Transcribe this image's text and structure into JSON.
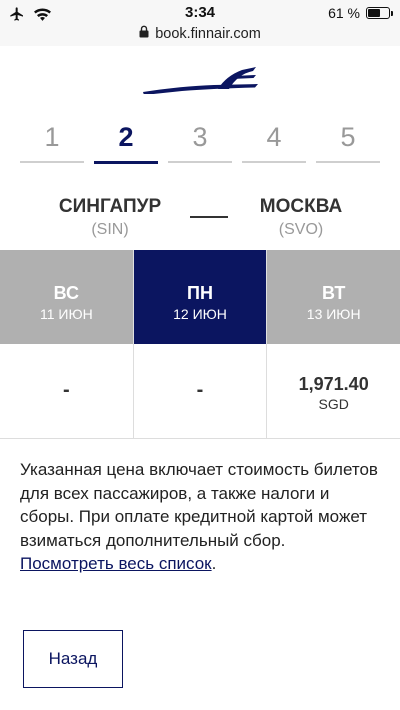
{
  "status_bar": {
    "time": "3:34",
    "battery_percent": "61 %",
    "battery_level": 0.61,
    "icons": [
      "airplane-icon",
      "wifi-icon",
      "battery-icon"
    ]
  },
  "browser": {
    "url": "book.finnair.com",
    "lock_icon": "lock-icon"
  },
  "brand": {
    "logo": "finnair-logo",
    "color": "#0b1560"
  },
  "steps": [
    {
      "label": "1"
    },
    {
      "label": "2"
    },
    {
      "label": "3"
    },
    {
      "label": "4"
    },
    {
      "label": "5"
    }
  ],
  "active_step": "2",
  "route": {
    "from_city": "СИНГАПУР",
    "from_code": "(SIN)",
    "to_city": "МОСКВА",
    "to_code": "(SVO)"
  },
  "days": [
    {
      "weekday": "ВС",
      "date": "11 ИЮН",
      "price": "-",
      "currency": ""
    },
    {
      "weekday": "ПН",
      "date": "12 ИЮН",
      "price": "-",
      "currency": ""
    },
    {
      "weekday": "ВТ",
      "date": "13 ИЮН",
      "price": "1,971.40",
      "currency": "SGD"
    }
  ],
  "selected_day": "ПН",
  "info": {
    "text": "Указанная цена включает стоимость билетов для всех пассажиров, а также налоги и сборы. При оплате кредитной картой может взиматься дополнительный сбор. ",
    "link": "Посмотреть весь список",
    "after": "."
  },
  "back_button": "Назад",
  "colors": {
    "selected_day_bg": "#0b1560",
    "day_bg": "#b0b0b0",
    "inactive_step": "#999999"
  }
}
